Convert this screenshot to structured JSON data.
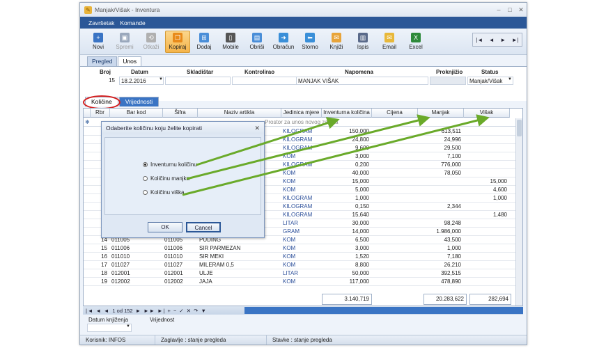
{
  "window": {
    "title": "Manjak/Višak - Inventura"
  },
  "menu": [
    "Završetak",
    "Komande"
  ],
  "toolbar": [
    {
      "label": "Novi",
      "icon": "new-icon",
      "state": "normal",
      "color": "#3a74c4"
    },
    {
      "label": "Spremi",
      "icon": "save-icon",
      "state": "disabled",
      "color": "#9aa8bc"
    },
    {
      "label": "Otkaži",
      "icon": "cancel-icon",
      "state": "disabled",
      "color": "#b0b0b0"
    },
    {
      "label": "Kopiraj",
      "icon": "copy-icon",
      "state": "selected",
      "color": "#e88a1a"
    },
    {
      "label": "Dodaj",
      "icon": "add-icon",
      "state": "normal",
      "color": "#4a8ed8"
    },
    {
      "label": "Mobile",
      "icon": "mobile-icon",
      "state": "normal",
      "color": "#555"
    },
    {
      "label": "Obriši",
      "icon": "delete-icon",
      "state": "normal",
      "color": "#4a8ed8"
    },
    {
      "label": "Obračun",
      "icon": "calc-icon",
      "state": "normal",
      "color": "#3a8fd8"
    },
    {
      "label": "Storno",
      "icon": "storno-icon",
      "state": "normal",
      "color": "#3a8fd8"
    },
    {
      "label": "Knjiži",
      "icon": "post-icon",
      "state": "normal",
      "color": "#e8a43a"
    },
    {
      "label": "Ispis",
      "icon": "print-icon",
      "state": "normal",
      "color": "#5a6a8a"
    },
    {
      "label": "Email",
      "icon": "email-icon",
      "state": "normal",
      "color": "#e8b83a"
    },
    {
      "label": "Excel",
      "icon": "excel-icon",
      "state": "normal",
      "color": "#2e8a3a"
    }
  ],
  "recordNav": [
    "|◄",
    "◄",
    "►",
    "►|"
  ],
  "tabsTop": [
    "Pregled",
    "Unos"
  ],
  "header": {
    "labels": [
      "Broj",
      "Datum",
      "Skladištar",
      "Kontrolirao",
      "Napomena",
      "Proknjižio",
      "Status"
    ],
    "broj": "15",
    "datum": "18.2.2016",
    "skladistar": "",
    "kontrolirao": "",
    "napomena": "MANJAK VIŠAK",
    "proknjizio": "",
    "status": "Manjak/Višak"
  },
  "tabsGrid": [
    "Količine",
    "Vrijednosti"
  ],
  "grid": {
    "columns": [
      "Rbr",
      "Bar kod",
      "Šifra",
      "Naziv artikla",
      "Jedinica mjere",
      "Inventurna količina",
      "Cijena",
      "Manjak",
      "Višak"
    ],
    "newRowText": "Prostor za unos novog zapisa",
    "rows": [
      [
        "",
        "",
        "",
        "",
        "KILOGRAM",
        "150,000",
        "",
        "613,511",
        ""
      ],
      [
        "",
        "",
        "",
        "",
        "KILOGRAM",
        "24,800",
        "",
        "24,996",
        ""
      ],
      [
        "",
        "",
        "",
        "",
        "KILOGRAM",
        "9,600",
        "",
        "29,500",
        ""
      ],
      [
        "",
        "",
        "",
        "",
        "KOM",
        "3,000",
        "",
        "7,100",
        ""
      ],
      [
        "",
        "",
        "",
        "",
        "KILOGRAM",
        "0,200",
        "",
        "776,000",
        ""
      ],
      [
        "",
        "",
        "",
        "",
        "KOM",
        "40,000",
        "",
        "78,050",
        ""
      ],
      [
        "",
        "",
        "",
        "",
        "KOM",
        "15,000",
        "",
        "",
        "15,000"
      ],
      [
        "",
        "",
        "",
        "",
        "KOM",
        "5,000",
        "",
        "",
        "4,600"
      ],
      [
        "",
        "",
        "",
        "",
        "KILOGRAM",
        "1,000",
        "",
        "",
        "1,000"
      ],
      [
        "",
        "",
        "",
        "",
        "KILOGRAM",
        "0,150",
        "",
        "2,344",
        ""
      ],
      [
        "",
        "",
        "",
        "",
        "KILOGRAM",
        "15,640",
        "",
        "",
        "1,480"
      ],
      [
        "",
        "",
        "",
        "LE",
        "LITAR",
        "30,000",
        "",
        "98,248",
        ""
      ],
      [
        "",
        "",
        "",
        "",
        "GRAM",
        "14,000",
        "",
        "1.986,000",
        ""
      ],
      [
        "14",
        "011005",
        "011005",
        "PUDING",
        "KOM",
        "6,500",
        "",
        "43,500",
        ""
      ],
      [
        "15",
        "011006",
        "011006",
        "SIR PARMEZAN",
        "KOM",
        "3,000",
        "",
        "1,000",
        ""
      ],
      [
        "16",
        "011010",
        "011010",
        "SIR MEKI",
        "KOM",
        "1,520",
        "",
        "7,180",
        ""
      ],
      [
        "17",
        "011027",
        "011027",
        "MILERAM 0,5",
        "KOM",
        "8,800",
        "",
        "26,210",
        ""
      ],
      [
        "18",
        "012001",
        "012001",
        "ULJE",
        "LITAR",
        "50,000",
        "",
        "392,515",
        ""
      ],
      [
        "19",
        "012002",
        "012002",
        "JAJA",
        "KOM",
        "117,000",
        "",
        "478,890",
        ""
      ]
    ],
    "totals": {
      "inventurna": "3.140,719",
      "manjak": "20.283,622",
      "visak": "282,694"
    }
  },
  "navbar": {
    "position": "1 od 152"
  },
  "filter": {
    "labels": [
      "Datum knjiženja",
      "Vrijednost"
    ]
  },
  "statusbar": [
    "Korisnik: INFOS",
    "Zaglavlje : stanje pregleda",
    "Stavke : stanje pregleda"
  ],
  "dialog": {
    "title": "Odaberite količinu koju želite kopirati",
    "options": [
      "Inventurnu količinu",
      "Količinu manjka",
      "Količinu viška"
    ],
    "selected": 0,
    "ok": "OK",
    "cancel": "Cancel"
  }
}
